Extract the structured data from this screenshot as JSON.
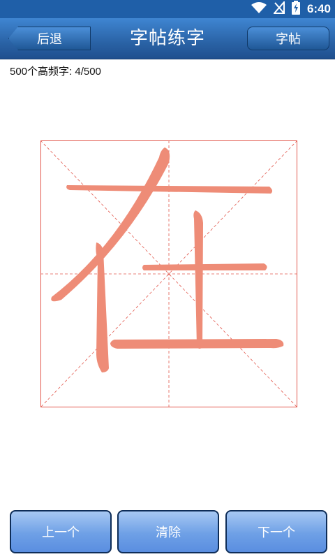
{
  "status_bar": {
    "time": "6:40",
    "icons": [
      "wifi-icon",
      "no-signal-icon",
      "battery-charging-icon"
    ]
  },
  "header": {
    "back_label": "后退",
    "title": "字帖练字",
    "copybook_label": "字帖"
  },
  "progress": {
    "text": "500个高频字: 4/500"
  },
  "practice": {
    "character": "在"
  },
  "bottom": {
    "prev_label": "上一个",
    "clear_label": "清除",
    "next_label": "下一个"
  },
  "colors": {
    "header_blue": "#2a63a6",
    "stroke_salmon": "#ee8c77",
    "grid_red": "#e2574c",
    "button_blue": "#6ea0e6"
  }
}
